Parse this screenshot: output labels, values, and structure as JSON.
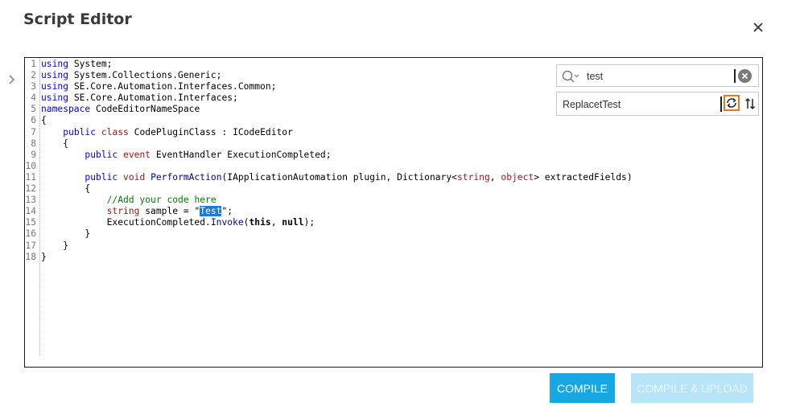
{
  "dialog": {
    "title": "Script Editor",
    "close_icon": "close-icon",
    "expand_icon": "chevron-right-icon"
  },
  "find": {
    "value": "test",
    "search_icon": "search-icon",
    "clear_icon": "clear-circle-icon"
  },
  "replace": {
    "value": "ReplacetTest",
    "replace_icon": "replace-icon",
    "swap_icon": "swap-icon"
  },
  "code_lines": [
    {
      "n": "1",
      "tokens": [
        {
          "t": "using",
          "c": "kw"
        },
        {
          "t": " System;"
        }
      ]
    },
    {
      "n": "2",
      "tokens": [
        {
          "t": "using",
          "c": "kw"
        },
        {
          "t": " System.Collections.Generic;"
        }
      ]
    },
    {
      "n": "3",
      "tokens": [
        {
          "t": "using",
          "c": "kw"
        },
        {
          "t": " SE.Core.Automation.Interfaces.Common;"
        }
      ]
    },
    {
      "n": "4",
      "tokens": [
        {
          "t": "using",
          "c": "kw"
        },
        {
          "t": " SE.Core.Automation.Interfaces;"
        }
      ]
    },
    {
      "n": "5",
      "tokens": [
        {
          "t": "namespace",
          "c": "kw"
        },
        {
          "t": " CodeEditorNameSpace"
        }
      ]
    },
    {
      "n": "6",
      "tokens": [
        {
          "t": "{"
        }
      ]
    },
    {
      "n": "7",
      "tokens": [
        {
          "t": "    "
        },
        {
          "t": "public",
          "c": "kw"
        },
        {
          "t": " "
        },
        {
          "t": "class",
          "c": "ty"
        },
        {
          "t": " CodePluginClass : ICodeEditor"
        }
      ]
    },
    {
      "n": "8",
      "tokens": [
        {
          "t": "    {"
        }
      ]
    },
    {
      "n": "9",
      "tokens": [
        {
          "t": "        "
        },
        {
          "t": "public",
          "c": "kw"
        },
        {
          "t": " "
        },
        {
          "t": "event",
          "c": "ty"
        },
        {
          "t": " EventHandler ExecutionCompleted;"
        }
      ]
    },
    {
      "n": "10",
      "tokens": [
        {
          "t": ""
        }
      ]
    },
    {
      "n": "11",
      "tokens": [
        {
          "t": "        "
        },
        {
          "t": "public",
          "c": "kw"
        },
        {
          "t": " "
        },
        {
          "t": "void",
          "c": "ty"
        },
        {
          "t": " "
        },
        {
          "t": "PerformAction",
          "c": "mt"
        },
        {
          "t": "(IApplicationAutomation plugin, Dictionary<"
        },
        {
          "t": "string",
          "c": "ty"
        },
        {
          "t": ", "
        },
        {
          "t": "object",
          "c": "ty"
        },
        {
          "t": "> extractedFields)"
        }
      ]
    },
    {
      "n": "12",
      "tokens": [
        {
          "t": "        {"
        }
      ]
    },
    {
      "n": "13",
      "tokens": [
        {
          "t": "            "
        },
        {
          "t": "//Add your code here",
          "c": "cm"
        }
      ]
    },
    {
      "n": "14",
      "tokens": [
        {
          "t": "            "
        },
        {
          "t": "string",
          "c": "ty"
        },
        {
          "t": " sample = \""
        },
        {
          "t": "Test",
          "c": "hl"
        },
        {
          "t": "\";"
        }
      ]
    },
    {
      "n": "15",
      "tokens": [
        {
          "t": "            ExecutionCompleted."
        },
        {
          "t": "Invoke",
          "c": "mt"
        },
        {
          "t": "("
        },
        {
          "t": "this",
          "c": "bd"
        },
        {
          "t": ", "
        },
        {
          "t": "null",
          "c": "bd"
        },
        {
          "t": ");"
        }
      ]
    },
    {
      "n": "16",
      "tokens": [
        {
          "t": "        }"
        }
      ]
    },
    {
      "n": "17",
      "tokens": [
        {
          "t": "    }"
        }
      ]
    },
    {
      "n": "18",
      "tokens": [
        {
          "t": "}"
        }
      ]
    }
  ],
  "buttons": {
    "compile": "COMPILE",
    "compile_upload": "COMPILE & UPLOAD"
  },
  "colors": {
    "primary": "#16a7e4",
    "disabled": "#b7e4f7",
    "highlight": "#1e78d8",
    "focus": "#e87722"
  }
}
